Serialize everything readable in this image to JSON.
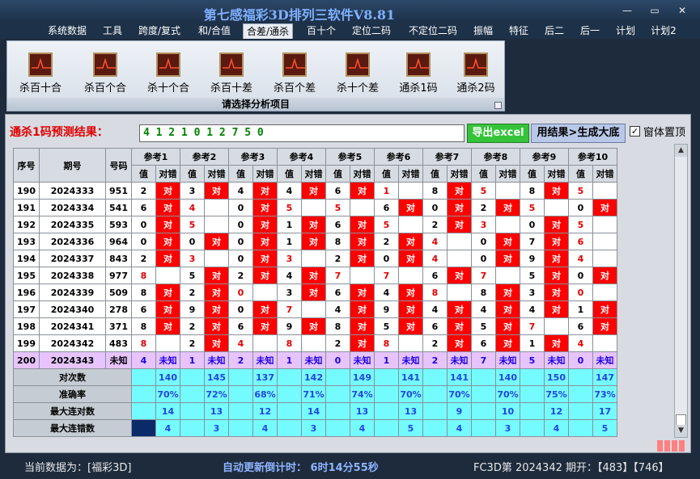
{
  "window": {
    "title": "第七感福彩3D排列三软件V8.81",
    "minimize": "—",
    "maximize": "▭",
    "close": "✕"
  },
  "menu": [
    "系统数据",
    "工具",
    "跨度/复式",
    "和/合值",
    "合差/通杀",
    "百十个",
    "定位二码",
    "不定位二码",
    "振幅",
    "特征",
    "后二",
    "后一",
    "计划",
    "计划2"
  ],
  "menu_active": "合差/通杀",
  "ribbon": {
    "buttons": [
      "杀百十合",
      "杀百个合",
      "杀十个合",
      "杀百十差",
      "杀百个差",
      "杀十个差",
      "通杀1码",
      "通杀2码"
    ],
    "footer": "请选择分析项目",
    "icon": "chart-icon"
  },
  "prediction": {
    "label": "通杀1码预测结果：",
    "value": "4 1 2 1 0 1 2 7 5 0"
  },
  "buttons": {
    "export": "导出excel",
    "generate": "用结果>生成大底"
  },
  "topmost": {
    "label": "窗体置顶",
    "checked": "✓"
  },
  "table": {
    "headers": {
      "idx": "序号",
      "period": "期号",
      "number": "号码",
      "refs": [
        "参考1",
        "参考2",
        "参考3",
        "参考4",
        "参考5",
        "参考6",
        "参考7",
        "参考8",
        "参考9",
        "参考10"
      ],
      "val": "值",
      "hit": "对错"
    },
    "hit_text": "对",
    "rows": [
      {
        "idx": "190",
        "period": "2024333",
        "num": "951",
        "v": [
          "2",
          "3",
          "4",
          "4",
          "6",
          "1",
          "8",
          "5",
          "8",
          "5"
        ],
        "h": [
          1,
          1,
          1,
          1,
          1,
          0,
          1,
          0,
          1,
          0
        ]
      },
      {
        "idx": "191",
        "period": "2024334",
        "num": "541",
        "v": [
          "6",
          "4",
          "0",
          "5",
          "5",
          "6",
          "0",
          "2",
          "5",
          "0"
        ],
        "h": [
          1,
          0,
          1,
          0,
          0,
          1,
          1,
          1,
          0,
          1
        ]
      },
      {
        "idx": "192",
        "period": "2024335",
        "num": "593",
        "v": [
          "0",
          "5",
          "0",
          "1",
          "6",
          "5",
          "2",
          "3",
          "0",
          "5"
        ],
        "h": [
          1,
          0,
          1,
          1,
          1,
          0,
          1,
          0,
          1,
          0
        ]
      },
      {
        "idx": "193",
        "period": "2024336",
        "num": "964",
        "v": [
          "0",
          "0",
          "0",
          "1",
          "8",
          "2",
          "4",
          "0",
          "7",
          "6"
        ],
        "h": [
          1,
          1,
          1,
          1,
          1,
          1,
          0,
          1,
          1,
          0
        ]
      },
      {
        "idx": "194",
        "period": "2024337",
        "num": "843",
        "v": [
          "2",
          "3",
          "0",
          "3",
          "2",
          "0",
          "4",
          "0",
          "9",
          "4"
        ],
        "h": [
          1,
          0,
          1,
          0,
          1,
          1,
          0,
          1,
          1,
          0
        ]
      },
      {
        "idx": "195",
        "period": "2024338",
        "num": "977",
        "v": [
          "8",
          "5",
          "2",
          "4",
          "7",
          "7",
          "6",
          "7",
          "5",
          "0"
        ],
        "h": [
          0,
          1,
          1,
          1,
          0,
          0,
          1,
          0,
          1,
          1
        ]
      },
      {
        "idx": "196",
        "period": "2024339",
        "num": "509",
        "v": [
          "8",
          "2",
          "0",
          "3",
          "6",
          "4",
          "8",
          "8",
          "3",
          "0"
        ],
        "h": [
          1,
          1,
          0,
          1,
          1,
          1,
          0,
          1,
          1,
          0
        ]
      },
      {
        "idx": "197",
        "period": "2024340",
        "num": "278",
        "v": [
          "6",
          "9",
          "0",
          "7",
          "4",
          "9",
          "4",
          "4",
          "4",
          "1"
        ],
        "h": [
          1,
          1,
          1,
          0,
          1,
          1,
          1,
          1,
          1,
          1
        ]
      },
      {
        "idx": "198",
        "period": "2024341",
        "num": "371",
        "v": [
          "8",
          "2",
          "6",
          "9",
          "8",
          "5",
          "6",
          "5",
          "7",
          "6"
        ],
        "h": [
          1,
          1,
          1,
          1,
          1,
          1,
          1,
          1,
          0,
          1
        ]
      },
      {
        "idx": "199",
        "period": "2024342",
        "num": "483",
        "v": [
          "8",
          "2",
          "4",
          "8",
          "2",
          "8",
          "2",
          "6",
          "1",
          "4"
        ],
        "h": [
          0,
          1,
          0,
          0,
          1,
          0,
          1,
          1,
          1,
          0
        ]
      }
    ],
    "pending": {
      "idx": "200",
      "period": "2024343",
      "num": "未知",
      "v": [
        "4",
        "1",
        "2",
        "1",
        "0",
        "1",
        "2",
        "7",
        "5",
        "0"
      ],
      "w": "未知"
    },
    "stats": [
      {
        "label": "对次数",
        "vals": [
          "140",
          "145",
          "137",
          "142",
          "149",
          "141",
          "141",
          "140",
          "150",
          "147"
        ]
      },
      {
        "label": "准确率",
        "vals": [
          "70%",
          "72%",
          "68%",
          "71%",
          "74%",
          "70%",
          "70%",
          "70%",
          "75%",
          "73%"
        ]
      },
      {
        "label": "最大连对数",
        "vals": [
          "14",
          "13",
          "12",
          "14",
          "13",
          "13",
          "9",
          "10",
          "12",
          "17"
        ]
      },
      {
        "label": "最大连错数",
        "vals": [
          "4",
          "3",
          "4",
          "3",
          "4",
          "5",
          "4",
          "3",
          "4",
          "5"
        ]
      }
    ]
  },
  "status": {
    "current": "当前数据为：[福彩3D]",
    "countdown": "自动更新倒计时：  6时14分55秒",
    "draw": "FC3D第 2024342 期开：【483】【746】"
  }
}
